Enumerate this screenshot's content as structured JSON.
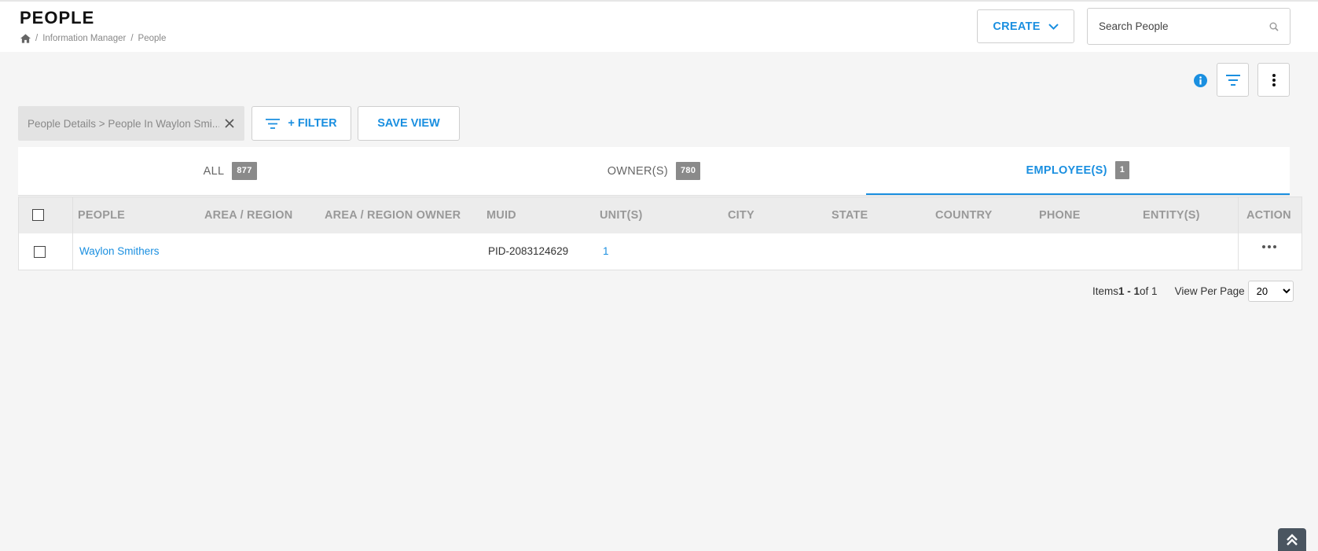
{
  "header": {
    "title": "PEOPLE",
    "breadcrumb": [
      "Information Manager",
      "People"
    ],
    "create_label": "CREATE",
    "search_placeholder": "Search People"
  },
  "toolbar": {
    "view_chip_label": "People Details > People In Waylon Smi...",
    "filter_label": "+ FILTER",
    "save_view_label": "SAVE VIEW"
  },
  "tabs": [
    {
      "label": "ALL",
      "count": "877",
      "active": false
    },
    {
      "label": "OWNER(S)",
      "count": "780",
      "active": false
    },
    {
      "label": "EMPLOYEE(S)",
      "count": "1",
      "active": true
    }
  ],
  "table": {
    "columns": [
      "PEOPLE",
      "AREA / REGION",
      "AREA / REGION OWNER",
      "MUID",
      "UNIT(S)",
      "CITY",
      "STATE",
      "COUNTRY",
      "PHONE",
      "ENTITY(S)",
      "ACTION"
    ],
    "rows": [
      {
        "people": "Waylon Smithers",
        "area_region": "",
        "area_region_owner": "",
        "muid": "PID-2083124629",
        "units": "1",
        "city": "",
        "state": "",
        "country": "",
        "phone": "",
        "entities": ""
      }
    ]
  },
  "pager": {
    "items_prefix": "Items ",
    "range": "1 - 1",
    "of_text": " of 1",
    "view_per_page_label": "View Per Page",
    "per_page": "20"
  },
  "colors": {
    "accent": "#1a8fe0",
    "badge": "#8a8a8a",
    "header_bg": "#ececec"
  }
}
